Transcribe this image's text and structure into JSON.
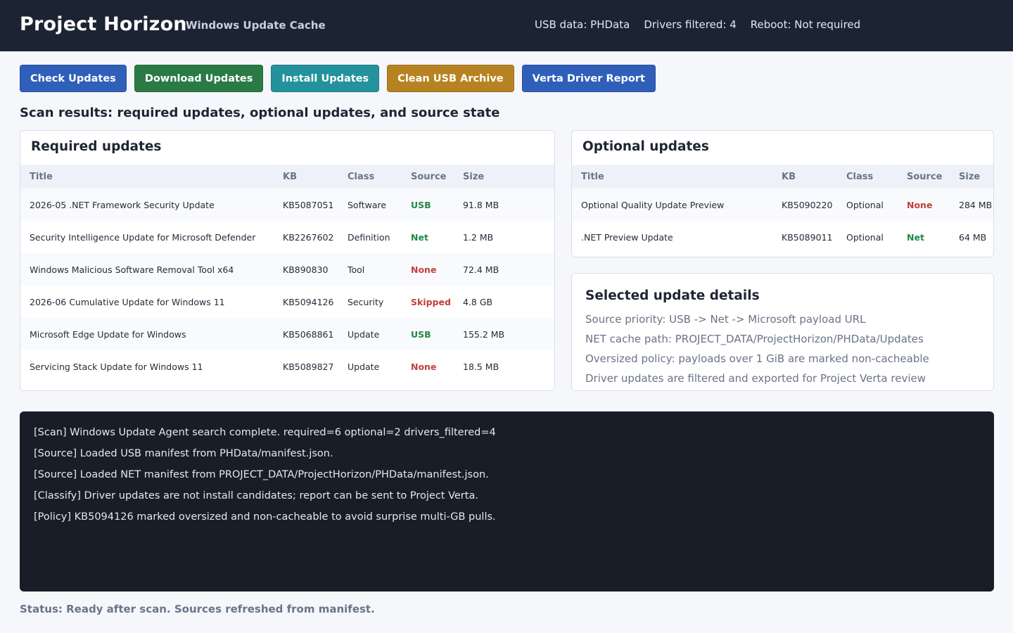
{
  "app": {
    "title": "Project Horizon",
    "subtitle": "Windows Update Cache"
  },
  "header_stats": {
    "usb_data": "USB data: PHData",
    "drivers_filtered": "Drivers filtered: 4",
    "reboot": "Reboot: Not required"
  },
  "toolbar": {
    "check": "Check Updates",
    "download": "Download Updates",
    "install": "Install Updates",
    "clean": "Clean USB Archive",
    "verta": "Verta Driver Report"
  },
  "section_heading": "Scan results: required updates, optional updates, and source state",
  "required": {
    "title": "Required updates",
    "columns": [
      "Title",
      "KB",
      "Class",
      "Source",
      "Size"
    ],
    "rows": [
      {
        "title": "2026-05 .NET Framework Security Update",
        "kb": "KB5087051",
        "class": "Software",
        "source": "USB",
        "size": "91.8 MB"
      },
      {
        "title": "Security Intelligence Update for Microsoft Defender",
        "kb": "KB2267602",
        "class": "Definition",
        "source": "Net",
        "size": "1.2 MB"
      },
      {
        "title": "Windows Malicious Software Removal Tool x64",
        "kb": "KB890830",
        "class": "Tool",
        "source": "None",
        "size": "72.4 MB"
      },
      {
        "title": "2026-06 Cumulative Update for Windows 11",
        "kb": "KB5094126",
        "class": "Security",
        "source": "Skipped",
        "size": "4.8 GB"
      },
      {
        "title": "Microsoft Edge Update for Windows",
        "kb": "KB5068861",
        "class": "Update",
        "source": "USB",
        "size": "155.2 MB"
      },
      {
        "title": "Servicing Stack Update for Windows 11",
        "kb": "KB5089827",
        "class": "Update",
        "source": "None",
        "size": "18.5 MB"
      }
    ]
  },
  "optional": {
    "title": "Optional updates",
    "columns": [
      "Title",
      "KB",
      "Class",
      "Source",
      "Size"
    ],
    "rows": [
      {
        "title": "Optional Quality Update Preview",
        "kb": "KB5090220",
        "class": "Optional",
        "source": "None",
        "size": "284 MB"
      },
      {
        "title": ".NET Preview Update",
        "kb": "KB5089011",
        "class": "Optional",
        "source": "Net",
        "size": "64 MB"
      }
    ]
  },
  "details": {
    "title": "Selected update details",
    "lines": [
      "Source priority: USB -> Net -> Microsoft payload URL",
      "NET cache path: PROJECT_DATA/ProjectHorizon/PHData/Updates",
      "Oversized policy: payloads over 1 GiB are marked non-cacheable",
      "Driver updates are filtered and exported for Project Verta review"
    ]
  },
  "log": [
    "[Scan] Windows Update Agent search complete. required=6 optional=2 drivers_filtered=4",
    "[Source] Loaded USB manifest from PHData/manifest.json.",
    "[Source] Loaded NET manifest from PROJECT_DATA/ProjectHorizon/PHData/manifest.json.",
    "[Classify] Driver updates are not install candidates; report can be sent to Project Verta.",
    "[Policy] KB5094126 marked oversized and non-cacheable to avoid surprise multi-GB pulls."
  ],
  "status": "Status: Ready after scan. Sources refreshed from manifest."
}
